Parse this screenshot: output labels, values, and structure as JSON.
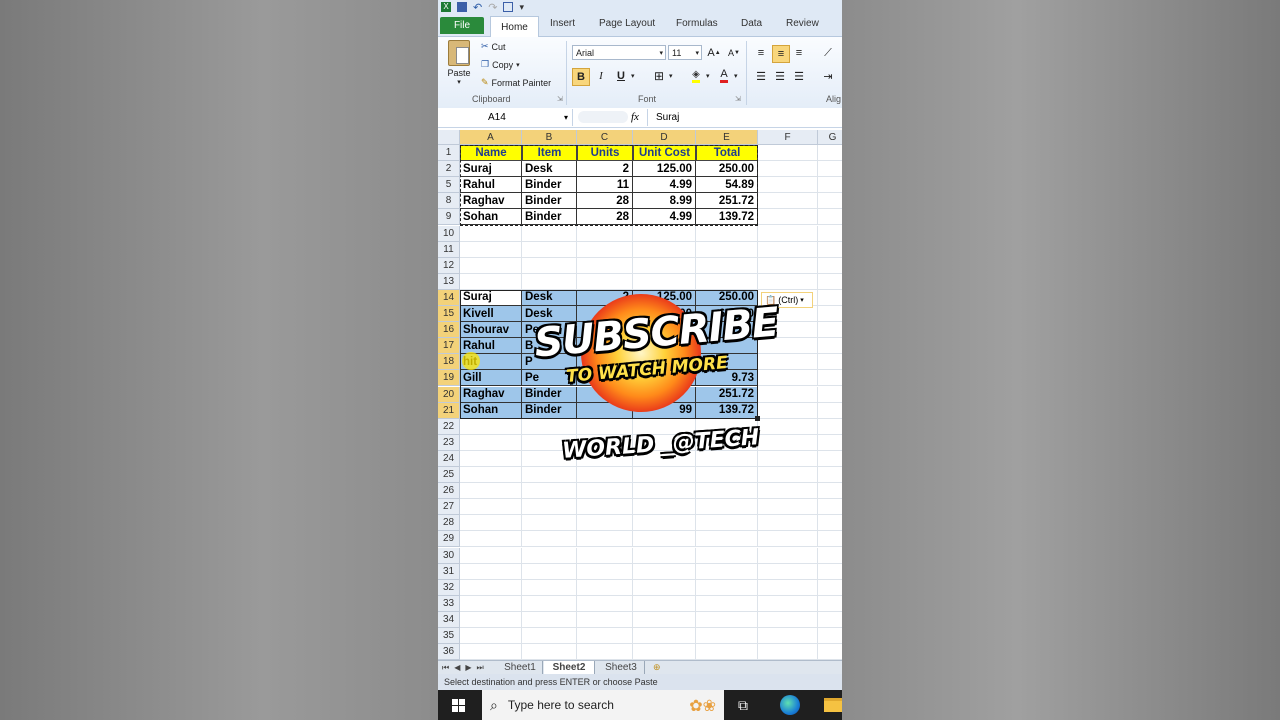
{
  "ribbon": {
    "tabs": [
      "File",
      "Home",
      "Insert",
      "Page Layout",
      "Formulas",
      "Data",
      "Review"
    ],
    "clipboard": {
      "paste": "Paste",
      "cut": "Cut",
      "copy": "Copy",
      "format_painter": "Format Painter",
      "group": "Clipboard"
    },
    "font": {
      "name": "Arial",
      "size": "11",
      "bold": "B",
      "italic": "I",
      "underline": "U",
      "group": "Font"
    },
    "alignment_group": "Alig"
  },
  "formula_bar": {
    "name_box": "A14",
    "fx": "fx",
    "value": "Suraj"
  },
  "columns": [
    "A",
    "B",
    "C",
    "D",
    "E",
    "F",
    "G"
  ],
  "table1": {
    "headers": [
      "Name",
      "Item",
      "Units",
      "Unit Cost",
      "Total"
    ],
    "rows": [
      {
        "row": "2",
        "name": "Suraj",
        "item": "Desk",
        "units": "2",
        "cost": "125.00",
        "total": "250.00"
      },
      {
        "row": "5",
        "name": "Rahul",
        "item": "Binder",
        "units": "11",
        "cost": "4.99",
        "total": "54.89"
      },
      {
        "row": "8",
        "name": "Raghav",
        "item": "Binder",
        "units": "28",
        "cost": "8.99",
        "total": "251.72"
      },
      {
        "row": "9",
        "name": "Sohan",
        "item": "Binder",
        "units": "28",
        "cost": "4.99",
        "total": "139.72"
      }
    ]
  },
  "table2": {
    "rows": [
      {
        "row": "14",
        "name": "Suraj",
        "item": "Desk",
        "units": "2",
        "cost": "125.00",
        "total": "250.00"
      },
      {
        "row": "15",
        "name": "Kivell",
        "item": "Desk",
        "units": "",
        "cost": "00",
        "total": "625.00"
      },
      {
        "row": "16",
        "name": "Shourav",
        "item": "Pencil",
        "units": "",
        "cost": "",
        "total": ""
      },
      {
        "row": "17",
        "name": "Rahul",
        "item": "B",
        "units": "",
        "cost": "",
        "total": ""
      },
      {
        "row": "18",
        "name": "hit",
        "item": "P",
        "units": "",
        "cost": "",
        "total": ""
      },
      {
        "row": "19",
        "name": "Gill",
        "item": "Pe",
        "units": "",
        "cost": "",
        "total": "9.73"
      },
      {
        "row": "20",
        "name": "Raghav",
        "item": "Binder",
        "units": "",
        "cost": "",
        "total": "251.72"
      },
      {
        "row": "21",
        "name": "Sohan",
        "item": "Binder",
        "units": "",
        "cost": "99",
        "total": "139.72"
      }
    ]
  },
  "empty_rows": [
    "10",
    "11",
    "12",
    "13"
  ],
  "lower_rows": [
    "22",
    "23",
    "24",
    "25",
    "26",
    "27",
    "28",
    "29",
    "30",
    "31",
    "32",
    "33",
    "34",
    "35",
    "36"
  ],
  "header_row": "1",
  "paste_options": "(Ctrl)",
  "sheet_tabs": [
    "Sheet1",
    "Sheet2",
    "Sheet3"
  ],
  "active_sheet": "Sheet2",
  "status_text": "Select destination and press ENTER or choose Paste",
  "taskbar": {
    "search_placeholder": "Type here to search"
  },
  "overlay": {
    "line1": "SUBSCRIBE",
    "line2": "TO WATCH MORE",
    "line3": "WORLD _@TECH"
  },
  "colors": {
    "header_fill": "#ffff00",
    "selection_fill": "#9ec6ea",
    "file_tab": "#2a8a3b",
    "selected_header": "#f3d27a"
  }
}
